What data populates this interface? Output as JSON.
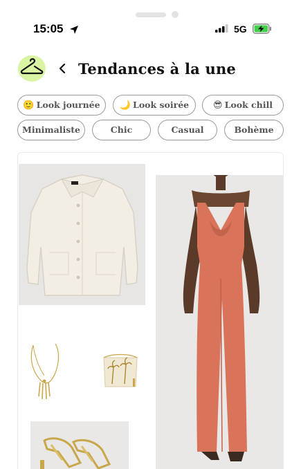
{
  "status": {
    "time": "15:05",
    "network": "5G"
  },
  "header": {
    "title": "Tendances à la une"
  },
  "filters": {
    "moods": [
      {
        "emoji": "🙂",
        "label": "Look journée"
      },
      {
        "emoji": "🌙",
        "label": "Look soirée"
      },
      {
        "emoji": "😎",
        "label": "Look chill"
      }
    ],
    "styles": [
      "Minimaliste",
      "Chic",
      "Casual",
      "Bohème"
    ]
  },
  "colors": {
    "accent_green": "#d9f4a3",
    "jumpsuit": "#d9735a",
    "jacket": "#f1ebe0",
    "gold": "#c8a64a"
  },
  "outfit_items": [
    "cream-jacket",
    "coral-jumpsuit",
    "gold-necklace",
    "palm-print-bag",
    "gold-heeled-sandals"
  ]
}
